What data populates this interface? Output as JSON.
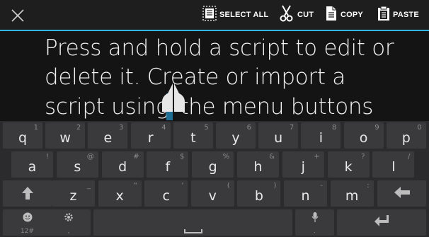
{
  "actionbar": {
    "close_icon": "close-x-icon",
    "select_all": "SELECT ALL",
    "cut": "CUT",
    "copy": "COPY",
    "paste": "PASTE"
  },
  "text": {
    "line1": "Press and hold a script to edit or",
    "line2": "delete it. Create or import a",
    "line3_before": "script using",
    "line3_after": "the menu buttons"
  },
  "keyboard": {
    "row1": [
      {
        "main": "q",
        "sub": "1"
      },
      {
        "main": "w",
        "sub": "2"
      },
      {
        "main": "e",
        "sub": "3"
      },
      {
        "main": "r",
        "sub": "4"
      },
      {
        "main": "t",
        "sub": "5"
      },
      {
        "main": "y",
        "sub": "6"
      },
      {
        "main": "u",
        "sub": "7"
      },
      {
        "main": "i",
        "sub": "8"
      },
      {
        "main": "o",
        "sub": "9"
      },
      {
        "main": "p",
        "sub": "0"
      }
    ],
    "row2": [
      {
        "main": "a",
        "sub": "!"
      },
      {
        "main": "s",
        "sub": "@"
      },
      {
        "main": "d",
        "sub": "#"
      },
      {
        "main": "f",
        "sub": "$"
      },
      {
        "main": "g",
        "sub": "%"
      },
      {
        "main": "h",
        "sub": "&"
      },
      {
        "main": "j",
        "sub": "+"
      },
      {
        "main": "k",
        "sub": "?"
      },
      {
        "main": "l",
        "sub": "/"
      }
    ],
    "row3": [
      {
        "main": "z",
        "sub": "_"
      },
      {
        "main": "x",
        "sub": "\""
      },
      {
        "main": "c",
        "sub": "'"
      },
      {
        "main": "v",
        "sub": "("
      },
      {
        "main": "b",
        "sub": ")"
      },
      {
        "main": "n",
        "sub": "-"
      },
      {
        "main": "m",
        "sub": ":"
      }
    ],
    "shift_icon": "shift-arrow-icon",
    "backspace_icon": "backspace-arrow-icon",
    "emoji_sub": "12#",
    "settings_sub": ",",
    "mic_sub": ".",
    "enter_icon": "enter-icon"
  },
  "colors": {
    "accent": "#33b5e5",
    "cursor": "#1f6f95",
    "key": "#3a3a3d",
    "keyboard_bg": "#2b2b2d"
  }
}
